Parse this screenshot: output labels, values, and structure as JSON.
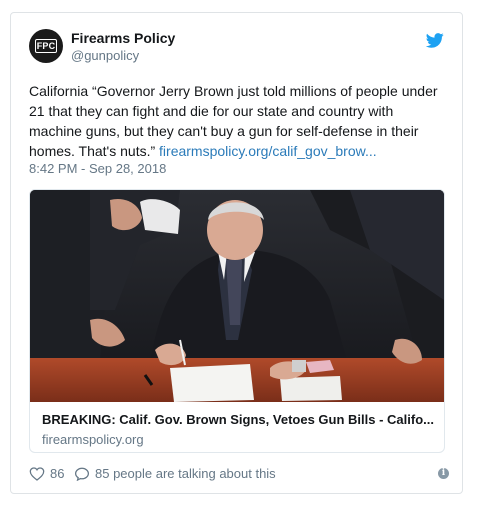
{
  "tweet": {
    "avatar_text": "FPC",
    "display_name": "Firearms Policy",
    "handle": "@gunpolicy",
    "text_body": "California “Governor Jerry Brown just told millions of people under 21 that they can fight and die for our state and country with machine guns, but they can't buy a gun for self-defense in their homes. That's nuts.” ",
    "link_text": "firearmspolicy.org/calif_gov_brow...",
    "timestamp": "8:42 PM - Sep 28, 2018"
  },
  "card": {
    "title": "BREAKING: Calif. Gov. Brown Signs, Vetoes Gun Bills - Califo...",
    "domain": "firearmspolicy.org",
    "image": "photo of a man in a dark suit seated at a wooden desk signing documents, surrounded by standing people in suits"
  },
  "actions": {
    "like_count": "86",
    "talk_text": "85 people are talking about this"
  },
  "icons": {
    "brand": "twitter-bird-icon",
    "like": "heart-icon",
    "reply": "speech-bubble-icon",
    "info": "info-icon"
  },
  "colors": {
    "link": "#2b7bb9",
    "twitter_blue": "#1da1f2",
    "muted": "#657786"
  }
}
